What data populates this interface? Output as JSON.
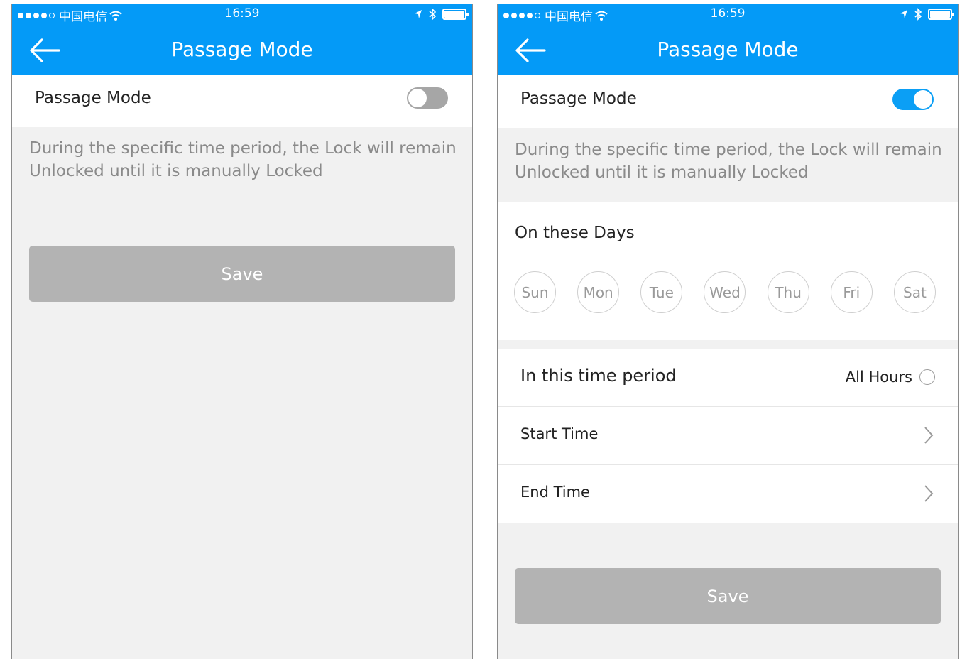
{
  "status_bar": {
    "carrier": "中国电信",
    "time": "16:59"
  },
  "screens": [
    {
      "nav_title": "Passage Mode",
      "passage_mode": {
        "label": "Passage Mode",
        "enabled": false
      },
      "description": "During the specific time period, the Lock will remain Unlocked until it is manually Locked",
      "save_label": "Save"
    },
    {
      "nav_title": "Passage Mode",
      "passage_mode": {
        "label": "Passage Mode",
        "enabled": true
      },
      "description": "During the specific time period, the Lock will remain Unlocked until it is manually Locked",
      "days_title": "On these Days",
      "days": [
        "Sun",
        "Mon",
        "Tue",
        "Wed",
        "Thu",
        "Fri",
        "Sat"
      ],
      "time_period_label": "In this time period",
      "all_hours_label": "All Hours",
      "start_time_label": "Start Time",
      "end_time_label": "End Time",
      "save_label": "Save"
    }
  ],
  "colors": {
    "accent": "#049af7",
    "toggle_on": "#0b9ff5",
    "toggle_off": "#a6a6a6",
    "button_disabled": "#b3b3b3",
    "background": "#f1f1f1"
  },
  "icons": [
    "back-arrow-icon",
    "wifi-icon",
    "location-icon",
    "bluetooth-icon",
    "battery-icon",
    "chevron-right-icon"
  ]
}
